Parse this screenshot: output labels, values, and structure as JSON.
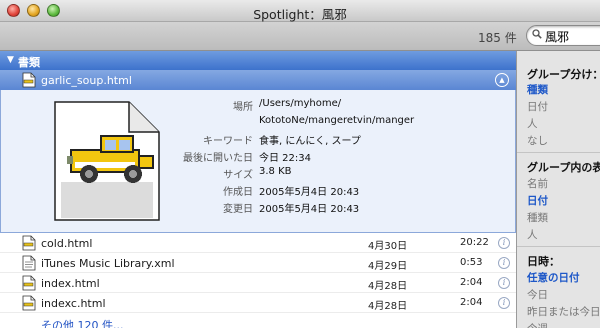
{
  "window": {
    "title": "Spotlight：風邪"
  },
  "toolbar": {
    "result_count": "185 件",
    "search_query": "風邪"
  },
  "results": {
    "group_title": "書類",
    "selected": {
      "name": "garlic_soup.html",
      "meta": [
        {
          "key": "場所",
          "value": "/Users/myhome/"
        },
        {
          "key": "",
          "value": "KototoNe/mangeretvin/manger"
        },
        {
          "key": "キーワード",
          "value": "食事, にんにく, スープ"
        },
        {
          "key": "最後に開いた日",
          "value": "今日 22:34"
        },
        {
          "key": "サイズ",
          "value": "3.8 KB"
        },
        {
          "key": "作成日",
          "value": "2005年5月4日  20:43"
        },
        {
          "key": "変更日",
          "value": "2005年5月4日  20:43"
        }
      ]
    },
    "files": [
      {
        "name": "cold.html",
        "date": "4月30日",
        "time": "20:22",
        "icon": "html-document-icon"
      },
      {
        "name": "iTunes Music Library.xml",
        "date": "4月29日",
        "time": "0:53",
        "icon": "xml-document-icon"
      },
      {
        "name": "index.html",
        "date": "4月28日",
        "time": "2:04",
        "icon": "html-document-icon"
      },
      {
        "name": "indexc.html",
        "date": "4月28日",
        "time": "2:04",
        "icon": "html-document-icon"
      }
    ],
    "more_link": "その他 120 件..."
  },
  "sidebar": {
    "group_by_title": "グループ分け：",
    "group_by_options": [
      "種類",
      "日付",
      "人",
      "なし"
    ],
    "group_by_selected": 0,
    "sort_title": "グループ内の表",
    "sort_options": [
      "名前",
      "日付",
      "種類",
      "人"
    ],
    "sort_selected": 1,
    "date_title": "日時：",
    "date_options": [
      "任意の日付",
      "今日",
      "昨日または今日",
      "今週"
    ],
    "date_selected": 0
  },
  "colors": {
    "selection": "#5a86d3",
    "link": "#2253c4",
    "sidebar_active": "#1e58c8"
  }
}
